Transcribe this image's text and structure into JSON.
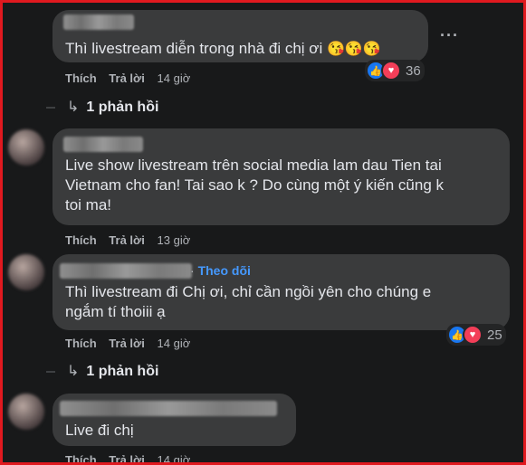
{
  "colors": {
    "accent": "#1877f2",
    "love": "#f33e58",
    "follow": "#4599ff",
    "border": "#e0191f"
  },
  "comments": [
    {
      "text": "Thì livestream diễn trong nhà đi chị ơi",
      "emojis": "😘😘😘",
      "like": "Thích",
      "reply": "Trả lời",
      "time": "14 giờ",
      "reaction_count": "36",
      "replies_label": "1 phản hồi",
      "more_icon": "more-icon"
    },
    {
      "text_line1": "Live show livestream trên social media lam dau Tien tai",
      "text_line2": "Vietnam cho fan! Tai sao k ? Do cùng một ý kiến cũng k",
      "text_line3": "toi ma!",
      "like": "Thích",
      "reply": "Trả lời",
      "time": "13 giờ"
    },
    {
      "follow": "Theo dõi",
      "follow_sep": "·",
      "text_line1": "Thì livestream đi Chị ơi, chỉ cần ngồi yên cho chúng e",
      "text_line2": "ngắm tí thoiii ạ",
      "like": "Thích",
      "reply": "Trả lời",
      "time": "14 giờ",
      "reaction_count": "25",
      "replies_label": "1 phản hồi"
    },
    {
      "text": "Live đi chị",
      "like": "Thích",
      "reply": "Trả lời",
      "time": "14 giờ"
    }
  ]
}
